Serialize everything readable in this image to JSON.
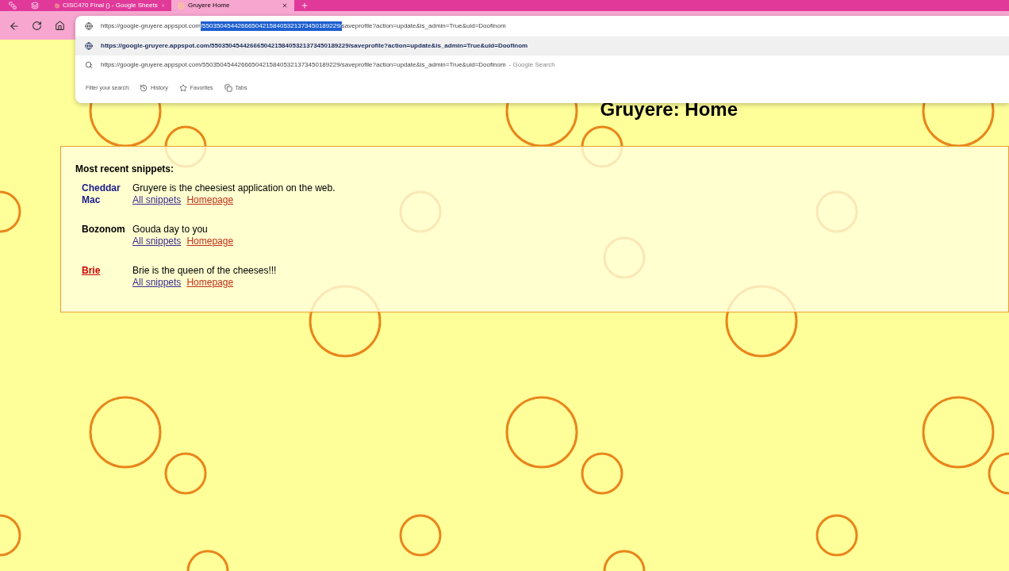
{
  "tabs": [
    {
      "title": "CISC470 Final () - Google Sheets",
      "selected": false
    },
    {
      "title": "Gruyere Home",
      "selected": true
    }
  ],
  "address_bar": {
    "prefix": "https://google-gruyere.appspot.com",
    "selected_text": "/550350454426665042158405321373450189229/",
    "suffix": "saveprofile?action=update&is_admin=True&uid=Doofinom"
  },
  "suggestions": [
    {
      "kind": "url",
      "text": "https://google-gruyere.appspot.com/550350454426665042158405321373450189229/saveprofile?action=update&is_admin=True&uid=Doofinom",
      "selected": true
    },
    {
      "kind": "search",
      "text": "https://google-gruyere.appspot.com/550350454426665042158405321373450189229/saveprofile?action=update&is_admin=True&uid=Doofinom",
      "hint": "- Google Search",
      "selected": false
    }
  ],
  "filter": {
    "label": "Filter your search:",
    "options": [
      "History",
      "Favorites",
      "Tabs"
    ]
  },
  "page": {
    "title": "Gruyere: Home",
    "snippets_heading": "Most recent snippets:",
    "snippets": [
      {
        "author": "Cheddar Mac",
        "color": "#1a1a8c",
        "text": "Gruyere is the cheesiest application on the web.",
        "links": [
          "All snippets",
          "Homepage"
        ]
      },
      {
        "author": "Bozonom",
        "color": "#000000",
        "text": "Gouda day to you",
        "links": [
          "All snippets",
          "Homepage"
        ]
      },
      {
        "author": "Brie",
        "color": "#cc0000",
        "text": "Brie is the queen of the cheeses!!!",
        "links": [
          "All snippets",
          "Homepage"
        ]
      }
    ]
  }
}
